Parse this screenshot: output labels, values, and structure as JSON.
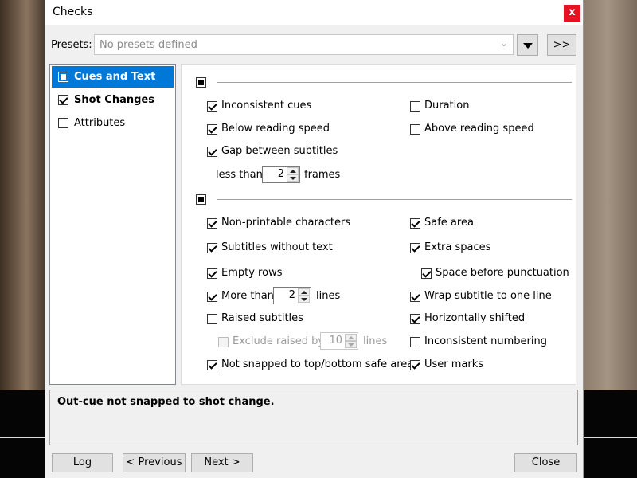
{
  "window": {
    "title": "Checks",
    "close_label": "x"
  },
  "presets": {
    "label": "Presets:",
    "value": "No presets defined",
    "more_label": ">>"
  },
  "nav": [
    {
      "label": "Cues and Text",
      "checked": "partial",
      "selected": true
    },
    {
      "label": "Shot Changes",
      "checked": true,
      "selected": false
    },
    {
      "label": "Attributes",
      "checked": false,
      "selected": false
    }
  ],
  "group1": {
    "left": [
      {
        "label": "Inconsistent cues",
        "checked": true
      },
      {
        "label": "Below reading speed",
        "checked": true
      },
      {
        "label": "Gap between subtitles",
        "checked": true
      }
    ],
    "right": [
      {
        "label": "Duration",
        "checked": false
      },
      {
        "label": "Above reading speed",
        "checked": false
      }
    ],
    "gap_prefix": "less than",
    "gap_value": "2",
    "gap_suffix": "frames"
  },
  "group2": {
    "left": [
      {
        "label": "Non-printable characters",
        "checked": true
      },
      {
        "label": "Subtitles without text",
        "checked": true
      },
      {
        "label": "Empty rows",
        "checked": true
      },
      {
        "label": "More than",
        "checked": true
      },
      {
        "label": "Raised subtitles",
        "checked": false
      },
      {
        "label": "Exclude raised by",
        "checked": false,
        "disabled": true
      },
      {
        "label": "Not snapped to top/bottom safe area",
        "checked": true
      }
    ],
    "more_than_value": "2",
    "more_than_suffix": "lines",
    "raised_value": "10",
    "raised_suffix": "lines",
    "right": [
      {
        "label": "Safe area",
        "checked": true
      },
      {
        "label": "Extra spaces",
        "checked": true
      },
      {
        "label": "Space before punctuation",
        "checked": true
      },
      {
        "label": "Wrap subtitle to one line",
        "checked": true
      },
      {
        "label": "Horizontally shifted",
        "checked": true
      },
      {
        "label": "Inconsistent numbering",
        "checked": false
      },
      {
        "label": "User marks",
        "checked": true
      }
    ]
  },
  "message": "Out-cue not snapped to shot change.",
  "buttons": {
    "log": "Log",
    "previous": "< Previous",
    "next": "Next >",
    "close": "Close"
  },
  "colors": {
    "selection": "#0078d7",
    "close_button": "#e81123"
  }
}
